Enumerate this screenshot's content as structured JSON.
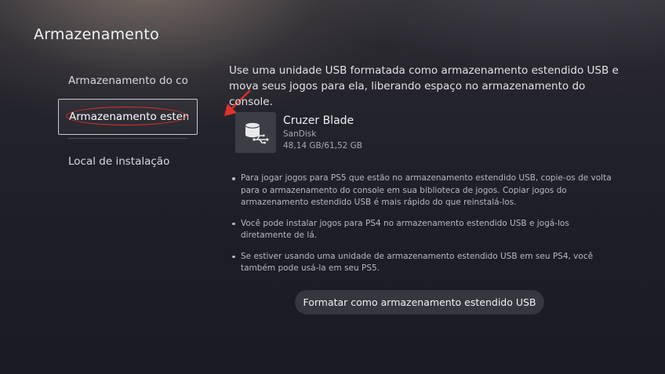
{
  "page": {
    "title": "Armazenamento"
  },
  "sidebar": {
    "items": [
      {
        "label": "Armazenamento do co..."
      },
      {
        "label": "Armazenamento estendi"
      },
      {
        "label": "Local de instalação"
      }
    ]
  },
  "main": {
    "intro": "Use uma unidade USB formatada como armazenamento estendido USB e mova seus jogos para ela, liberando espaço no armazenamento do console.",
    "drive": {
      "name": "Cruzer Blade",
      "brand": "SanDisk",
      "usage": "48,14 GB/61,52 GB",
      "icon": "usb-drive-icon"
    },
    "notes": [
      "Para jogar jogos para PS5 que estão no armazenamento estendido USB, copie-os de volta para o armazenamento do console em sua biblioteca de jogos. Copiar jogos do armazenamento estendido USB é mais rápido do que reinstalá-los.",
      "Você pode instalar jogos para PS4 no armazenamento estendido USB e jogá-los diretamente de lá.",
      "Se estiver usando uma unidade de armazenamento estendido USB em seu PS4, você também pode usá-la em seu PS5."
    ],
    "format_button": "Formatar como armazenamento estendido USB"
  },
  "annotations": {
    "highlight_color": "#e0312b"
  }
}
